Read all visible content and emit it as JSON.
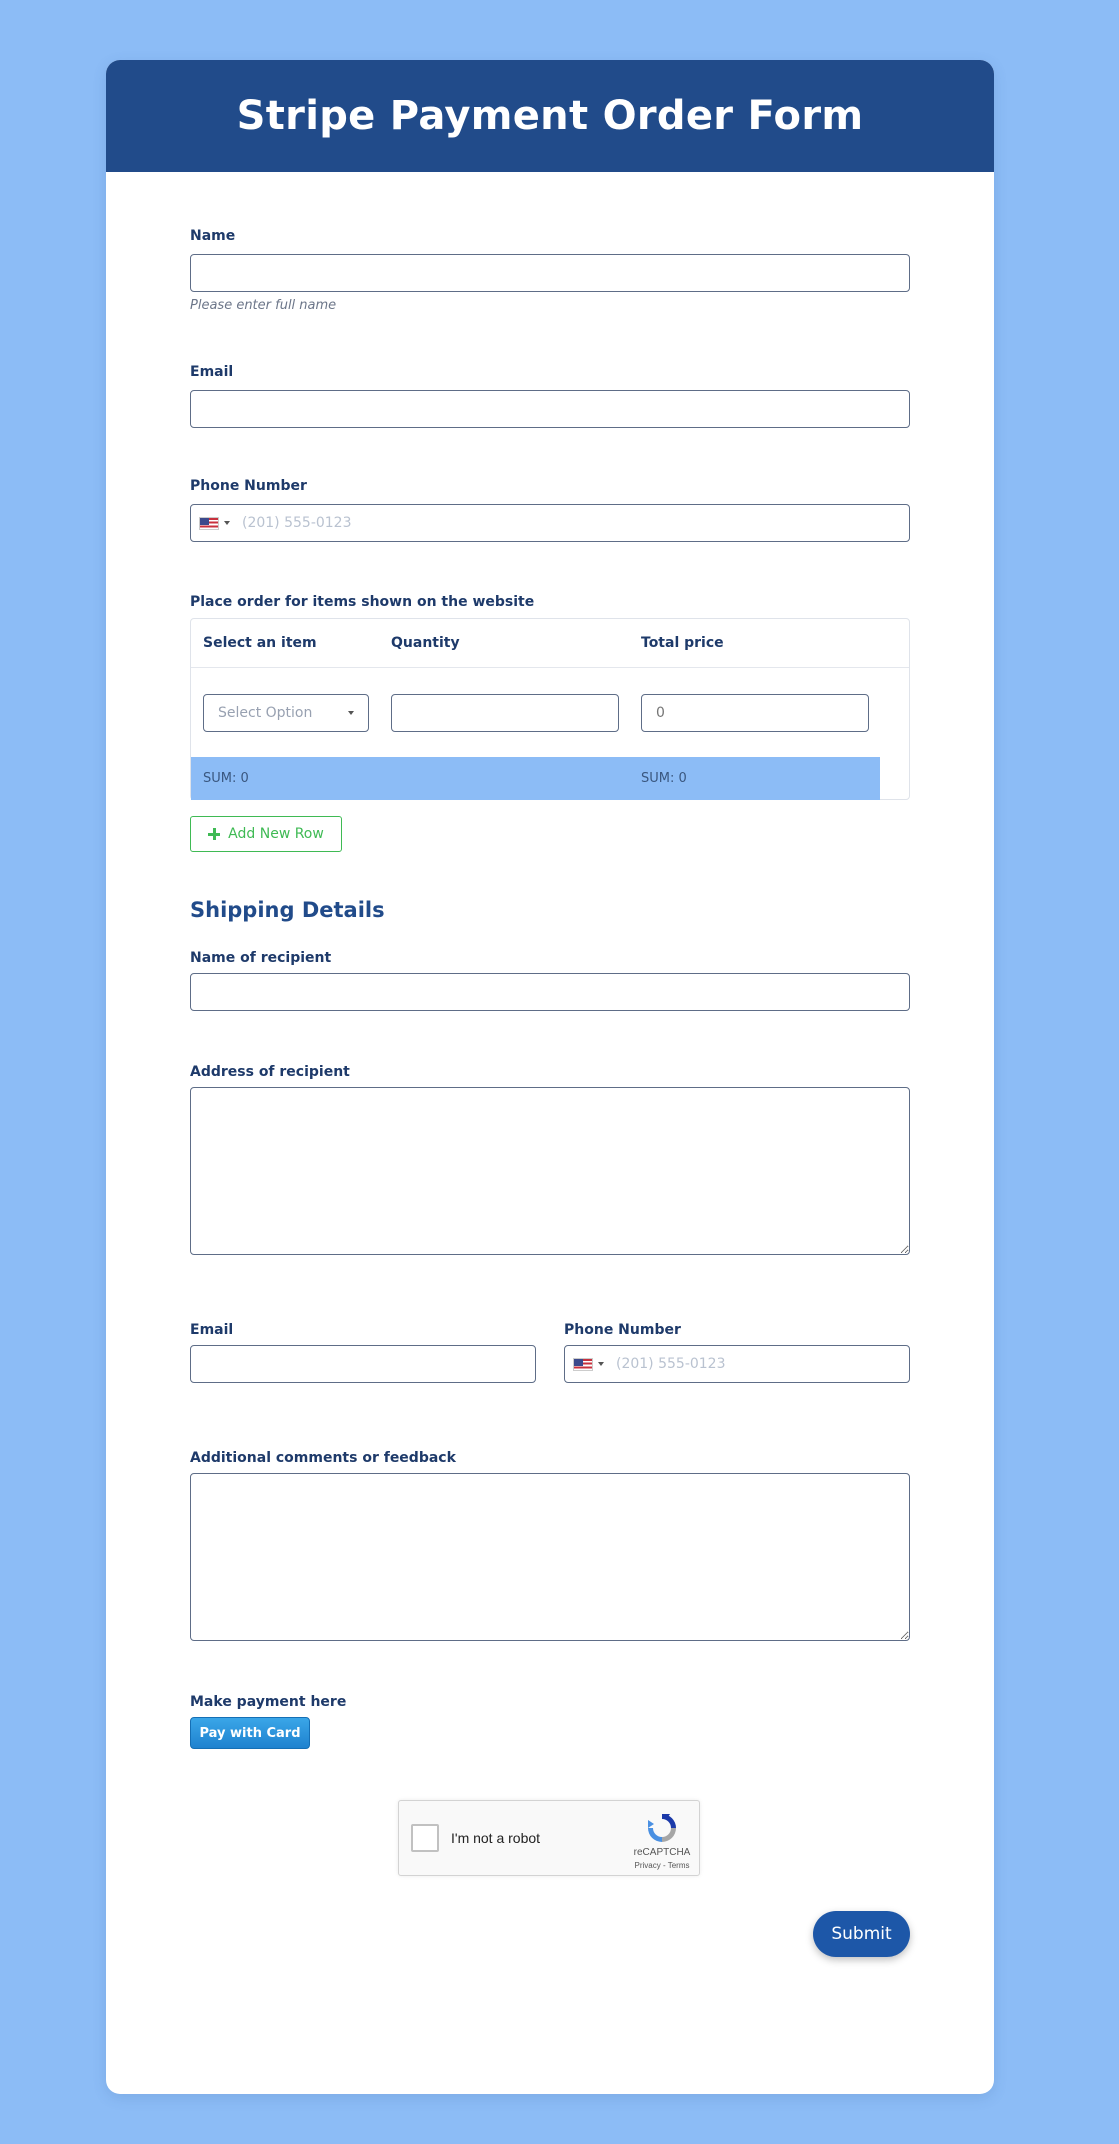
{
  "header": {
    "title": "Stripe Payment Order Form"
  },
  "name_field": {
    "label": "Name",
    "value": "",
    "hint": "Please enter full name"
  },
  "email_field": {
    "label": "Email",
    "value": ""
  },
  "phone_field": {
    "label": "Phone Number",
    "placeholder": "(201) 555-0123",
    "country": "US"
  },
  "order": {
    "label": "Place order for items shown on the website",
    "columns": [
      "Select an item",
      "Quantity",
      "Total price"
    ],
    "row": {
      "select_placeholder": "Select Option",
      "quantity": "",
      "total_placeholder": "0"
    },
    "sums": [
      "SUM: 0",
      "SUM: 0"
    ],
    "add_row_label": "Add New Row"
  },
  "shipping": {
    "title": "Shipping Details",
    "recipient_name_label": "Name of recipient",
    "recipient_address_label": "Address of recipient",
    "email_label": "Email",
    "phone_label": "Phone Number",
    "phone_placeholder": "(201) 555-0123",
    "comments_label": "Additional comments or feedback"
  },
  "payment": {
    "label": "Make payment here",
    "button_label": "Pay with Card"
  },
  "recaptcha": {
    "text": "I'm not a robot",
    "brand": "reCAPTCHA",
    "links": "Privacy - Terms"
  },
  "submit": {
    "label": "Submit"
  },
  "colors": {
    "background": "#8cbcf6",
    "header": "#214b8a",
    "submit": "#1d57a8",
    "add_row": "#3fba54",
    "pay_button": "#1f82cf"
  }
}
